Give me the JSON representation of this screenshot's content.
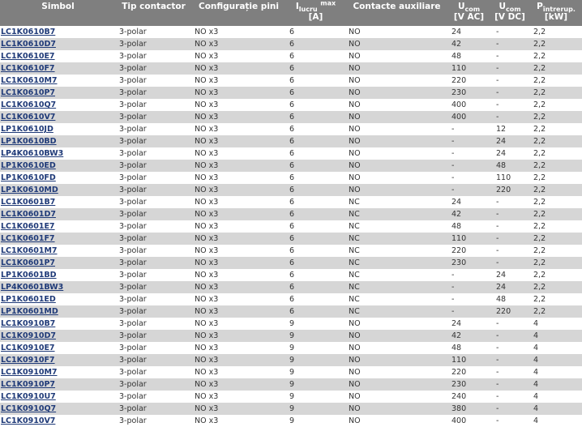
{
  "headers": {
    "simbol": "Simbol",
    "tip": "Tip contactor",
    "config": "Configurație pini",
    "i_main": "I",
    "i_sub": "lucru",
    "i_sup": "max",
    "i_unit": "[A]",
    "aux": "Contacte auxiliare",
    "uac_main": "U",
    "uac_sub": "com",
    "uac_unit": "[V AC]",
    "udc_main": "U",
    "udc_sub": "com",
    "udc_unit": "[V DC]",
    "p_main": "P",
    "p_sub": "întrerup.",
    "p_unit": "[kW]"
  },
  "rows": [
    {
      "simbol": "LC1K0610B7",
      "tip": "3-polar",
      "config": "NO x3",
      "i": "6",
      "aux": "NO",
      "uac": "24",
      "udc": "-",
      "p": "2,2"
    },
    {
      "simbol": "LC1K0610D7",
      "tip": "3-polar",
      "config": "NO x3",
      "i": "6",
      "aux": "NO",
      "uac": "42",
      "udc": "-",
      "p": "2,2"
    },
    {
      "simbol": "LC1K0610E7",
      "tip": "3-polar",
      "config": "NO x3",
      "i": "6",
      "aux": "NO",
      "uac": "48",
      "udc": "-",
      "p": "2,2"
    },
    {
      "simbol": "LC1K0610F7",
      "tip": "3-polar",
      "config": "NO x3",
      "i": "6",
      "aux": "NO",
      "uac": "110",
      "udc": "-",
      "p": "2,2"
    },
    {
      "simbol": "LC1K0610M7",
      "tip": "3-polar",
      "config": "NO x3",
      "i": "6",
      "aux": "NO",
      "uac": "220",
      "udc": "-",
      "p": "2,2"
    },
    {
      "simbol": "LC1K0610P7",
      "tip": "3-polar",
      "config": "NO x3",
      "i": "6",
      "aux": "NO",
      "uac": "230",
      "udc": "-",
      "p": "2,2"
    },
    {
      "simbol": "LC1K0610Q7",
      "tip": "3-polar",
      "config": "NO x3",
      "i": "6",
      "aux": "NO",
      "uac": "400",
      "udc": "-",
      "p": "2,2"
    },
    {
      "simbol": "LC1K0610V7",
      "tip": "3-polar",
      "config": "NO x3",
      "i": "6",
      "aux": "NO",
      "uac": "400",
      "udc": "-",
      "p": "2,2"
    },
    {
      "simbol": "LP1K0610JD",
      "tip": "3-polar",
      "config": "NO x3",
      "i": "6",
      "aux": "NO",
      "uac": "-",
      "udc": "12",
      "p": "2,2"
    },
    {
      "simbol": "LP1K0610BD",
      "tip": "3-polar",
      "config": "NO x3",
      "i": "6",
      "aux": "NO",
      "uac": "-",
      "udc": "24",
      "p": "2,2"
    },
    {
      "simbol": "LP4K0610BW3",
      "tip": "3-polar",
      "config": "NO x3",
      "i": "6",
      "aux": "NO",
      "uac": "-",
      "udc": "24",
      "p": "2,2"
    },
    {
      "simbol": "LP1K0610ED",
      "tip": "3-polar",
      "config": "NO x3",
      "i": "6",
      "aux": "NO",
      "uac": "-",
      "udc": "48",
      "p": "2,2"
    },
    {
      "simbol": "LP1K0610FD",
      "tip": "3-polar",
      "config": "NO x3",
      "i": "6",
      "aux": "NO",
      "uac": "-",
      "udc": "110",
      "p": "2,2"
    },
    {
      "simbol": "LP1K0610MD",
      "tip": "3-polar",
      "config": "NO x3",
      "i": "6",
      "aux": "NO",
      "uac": "-",
      "udc": "220",
      "p": "2,2"
    },
    {
      "simbol": "LC1K0601B7",
      "tip": "3-polar",
      "config": "NO x3",
      "i": "6",
      "aux": "NC",
      "uac": "24",
      "udc": "-",
      "p": "2,2"
    },
    {
      "simbol": "LC1K0601D7",
      "tip": "3-polar",
      "config": "NO x3",
      "i": "6",
      "aux": "NC",
      "uac": "42",
      "udc": "-",
      "p": "2,2"
    },
    {
      "simbol": "LC1K0601E7",
      "tip": "3-polar",
      "config": "NO x3",
      "i": "6",
      "aux": "NC",
      "uac": "48",
      "udc": "-",
      "p": "2,2"
    },
    {
      "simbol": "LC1K0601F7",
      "tip": "3-polar",
      "config": "NO x3",
      "i": "6",
      "aux": "NC",
      "uac": "110",
      "udc": "-",
      "p": "2,2"
    },
    {
      "simbol": "LC1K0601M7",
      "tip": "3-polar",
      "config": "NO x3",
      "i": "6",
      "aux": "NC",
      "uac": "220",
      "udc": "-",
      "p": "2,2"
    },
    {
      "simbol": "LC1K0601P7",
      "tip": "3-polar",
      "config": "NO x3",
      "i": "6",
      "aux": "NC",
      "uac": "230",
      "udc": "-",
      "p": "2,2"
    },
    {
      "simbol": "LP1K0601BD",
      "tip": "3-polar",
      "config": "NO x3",
      "i": "6",
      "aux": "NC",
      "uac": "-",
      "udc": "24",
      "p": "2,2"
    },
    {
      "simbol": "LP4K0601BW3",
      "tip": "3-polar",
      "config": "NO x3",
      "i": "6",
      "aux": "NC",
      "uac": "-",
      "udc": "24",
      "p": "2,2"
    },
    {
      "simbol": "LP1K0601ED",
      "tip": "3-polar",
      "config": "NO x3",
      "i": "6",
      "aux": "NC",
      "uac": "-",
      "udc": "48",
      "p": "2,2"
    },
    {
      "simbol": "LP1K0601MD",
      "tip": "3-polar",
      "config": "NO x3",
      "i": "6",
      "aux": "NC",
      "uac": "-",
      "udc": "220",
      "p": "2,2"
    },
    {
      "simbol": "LC1K0910B7",
      "tip": "3-polar",
      "config": "NO x3",
      "i": "9",
      "aux": "NO",
      "uac": "24",
      "udc": "-",
      "p": "4"
    },
    {
      "simbol": "LC1K0910D7",
      "tip": "3-polar",
      "config": "NO x3",
      "i": "9",
      "aux": "NO",
      "uac": "42",
      "udc": "-",
      "p": "4"
    },
    {
      "simbol": "LC1K0910E7",
      "tip": "3-polar",
      "config": "NO x3",
      "i": "9",
      "aux": "NO",
      "uac": "48",
      "udc": "-",
      "p": "4"
    },
    {
      "simbol": "LC1K0910F7",
      "tip": "3-polar",
      "config": "NO x3",
      "i": "9",
      "aux": "NO",
      "uac": "110",
      "udc": "-",
      "p": "4"
    },
    {
      "simbol": "LC1K0910M7",
      "tip": "3-polar",
      "config": "NO x3",
      "i": "9",
      "aux": "NO",
      "uac": "220",
      "udc": "-",
      "p": "4"
    },
    {
      "simbol": "LC1K0910P7",
      "tip": "3-polar",
      "config": "NO x3",
      "i": "9",
      "aux": "NO",
      "uac": "230",
      "udc": "-",
      "p": "4"
    },
    {
      "simbol": "LC1K0910U7",
      "tip": "3-polar",
      "config": "NO x3",
      "i": "9",
      "aux": "NO",
      "uac": "240",
      "udc": "-",
      "p": "4"
    },
    {
      "simbol": "LC1K0910Q7",
      "tip": "3-polar",
      "config": "NO x3",
      "i": "9",
      "aux": "NO",
      "uac": "380",
      "udc": "-",
      "p": "4"
    },
    {
      "simbol": "LC1K0910V7",
      "tip": "3-polar",
      "config": "NO x3",
      "i": "9",
      "aux": "NO",
      "uac": "400",
      "udc": "-",
      "p": "4"
    }
  ]
}
